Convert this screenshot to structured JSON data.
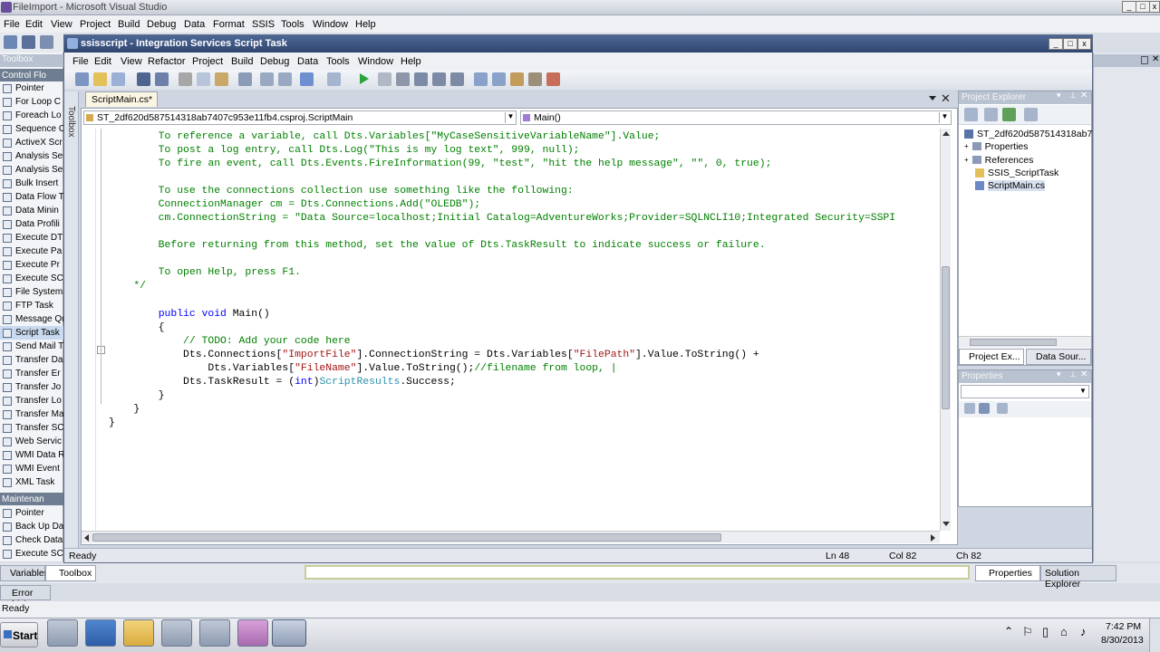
{
  "outer": {
    "title": "FileImport - Microsoft Visual Studio",
    "menu": [
      "File",
      "Edit",
      "View",
      "Project",
      "Build",
      "Debug",
      "Data",
      "Format",
      "SSIS",
      "Tools",
      "Window",
      "Help"
    ]
  },
  "inner": {
    "title": "ssisscript - Integration Services Script Task",
    "menu": [
      "File",
      "Edit",
      "View",
      "Refactor",
      "Project",
      "Build",
      "Debug",
      "Data",
      "Tools",
      "Window",
      "Help"
    ]
  },
  "toolbox": {
    "title": "Toolbox",
    "section1": "Control Flo",
    "items1": [
      "Pointer",
      "For Loop C",
      "Foreach Lo",
      "Sequence C",
      "ActiveX Scr",
      "Analysis Ser",
      "Analysis Ser",
      "Bulk Insert",
      "Data Flow T",
      "Data Minin",
      "Data Profili",
      "Execute DT",
      "Execute Pa",
      "Execute Pr",
      "Execute SC",
      "File System",
      "FTP Task",
      "Message Qu",
      "Script Task",
      "Send Mail T",
      "Transfer Da",
      "Transfer Er",
      "Transfer Jo",
      "Transfer Lo",
      "Transfer Ma",
      "Transfer SC",
      "Web Servic",
      "WMI Data R",
      "WMI Event",
      "XML Task"
    ],
    "section2": "Maintenan",
    "items2": [
      "Pointer",
      "Back Up Da",
      "Check Data",
      "Execute SC"
    ],
    "side_tab": "Toolbox"
  },
  "editor": {
    "tab": "ScriptMain.cs*",
    "class_dropdown": "ST_2df620d587514318ab7407c953e11fb4.csproj.ScriptMain",
    "member_dropdown": "Main()"
  },
  "code": {
    "l1": "        To reference a variable, call Dts.Variables[\"MyCaseSensitiveVariableName\"].Value;",
    "l2": "        To post a log entry, call Dts.Log(\"This is my log text\", 999, null);",
    "l3": "        To fire an event, call Dts.Events.FireInformation(99, \"test\", \"hit the help message\", \"\", 0, true);",
    "l4": "        To use the connections collection use something like the following:",
    "l5": "        ConnectionManager cm = Dts.Connections.Add(\"OLEDB\");",
    "l6": "        cm.ConnectionString = \"Data Source=localhost;Initial Catalog=AdventureWorks;Provider=SQLNCLI10;Integrated Security=SSPI",
    "l7": "        Before returning from this method, set the value of Dts.TaskResult to indicate success or failure.",
    "l8": "        To open Help, press F1.",
    "l9": "    */",
    "l10_pre": "        ",
    "l10_kw1": "public",
    "l10_sp": " ",
    "l10_kw2": "void",
    "l10_rest": " Main()",
    "l11": "        {",
    "l12": "            // TODO: Add your code here",
    "l13_a": "            Dts.Connections[",
    "l13_s1": "\"ImportFile\"",
    "l13_b": "].ConnectionString = Dts.Variables[",
    "l13_s2": "\"FilePath\"",
    "l13_c": "].Value.ToString() +",
    "l14_a": "                Dts.Variables[",
    "l14_s1": "\"FileName\"",
    "l14_b": "].Value.ToString();",
    "l14_c": "//filename from loop, |",
    "l15_a": "            Dts.TaskResult = (",
    "l15_kw": "int",
    "l15_b": ")",
    "l15_ty": "ScriptResults",
    "l15_c": ".Success;",
    "l16": "        }",
    "l17": "    }",
    "l18": "}"
  },
  "status": {
    "text": "Ready",
    "ln": "Ln 48",
    "col": "Col 82",
    "ch": "Ch 82"
  },
  "project_explorer": {
    "title": "Project Explorer",
    "root": "ST_2df620d587514318ab7",
    "items": [
      "Properties",
      "References",
      "SSIS_ScriptTask",
      "ScriptMain.cs"
    ],
    "tab1": "Project Ex...",
    "tab2": "Data Sour..."
  },
  "properties": {
    "title": "Properties"
  },
  "bottom_tabs": {
    "variables": "Variables",
    "toolbox": "Toolbox",
    "properties": "Properties",
    "solution_explorer": "Solution Explorer",
    "error_list": "Error List"
  },
  "outer_status": "Ready",
  "taskbar": {
    "start": "Start",
    "time": "7:42 PM",
    "date": "8/30/2013"
  },
  "colors": {
    "comment": "#008000",
    "keyword": "#0000ff",
    "type": "#2b91af",
    "string": "#a31515",
    "toolbox_header": "#6f7d92"
  }
}
